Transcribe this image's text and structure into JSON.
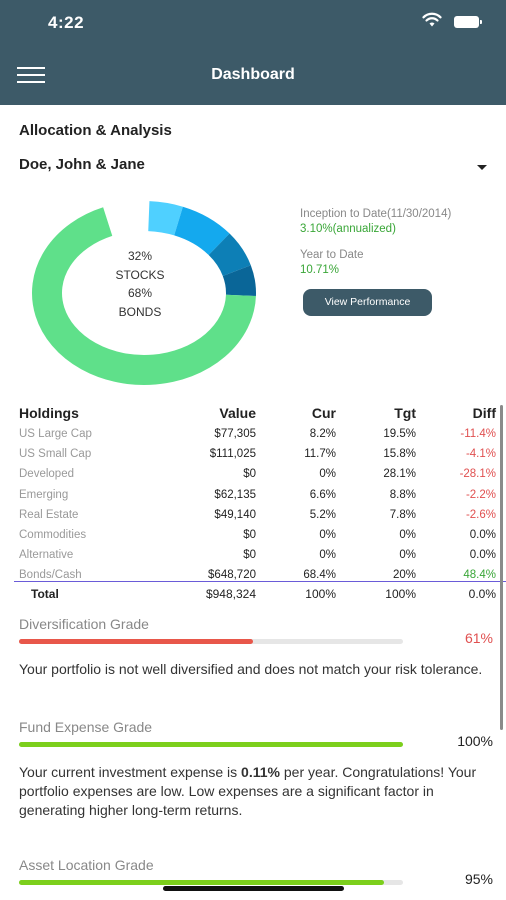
{
  "status_bar": {
    "time": "4:22",
    "wifi_icon": "wifi-icon",
    "battery_icon": "battery-icon"
  },
  "nav": {
    "menu_icon": "hamburger-menu-icon",
    "title": "Dashboard"
  },
  "section": {
    "title": "Allocation & Analysis"
  },
  "account": {
    "selected": "Doe, John & Jane",
    "chevron_icon": "chevron-down-icon"
  },
  "allocation": {
    "stocks_pct": "32%",
    "stocks_label": "STOCKS",
    "bonds_pct": "68%",
    "bonds_label": "BONDS",
    "segments": [
      {
        "color": "#4fd0ff",
        "fraction": 0.05
      },
      {
        "color": "#14a9ee",
        "fraction": 0.083
      },
      {
        "color": "#0d7fb6",
        "fraction": 0.062
      },
      {
        "color": "#0a6698",
        "fraction": 0.052
      },
      {
        "color": "#5fe08a",
        "fraction": 0.684
      }
    ],
    "colors": {
      "track": "#5fe08a"
    }
  },
  "performance": {
    "inception_label": "Inception to Date(11/30/2014)",
    "inception_value": "3.10%(annualized)",
    "ytd_label": "Year to Date",
    "ytd_value": "10.71%",
    "button_label": "View Performance"
  },
  "holdings": {
    "headers": [
      "Holdings",
      "Value",
      "Cur",
      "Tgt",
      "Diff"
    ],
    "rows": [
      {
        "name": "US Large Cap",
        "value": "$77,305",
        "cur": "8.2%",
        "tgt": "19.5%",
        "diff": "-11.4%",
        "sign": "neg"
      },
      {
        "name": "US Small Cap",
        "value": "$111,025",
        "cur": "11.7%",
        "tgt": "15.8%",
        "diff": "-4.1%",
        "sign": "neg"
      },
      {
        "name": "Developed",
        "value": "$0",
        "cur": "0%",
        "tgt": "28.1%",
        "diff": "-28.1%",
        "sign": "neg"
      },
      {
        "name": "Emerging",
        "value": "$62,135",
        "cur": "6.6%",
        "tgt": "8.8%",
        "diff": "-2.2%",
        "sign": "neg"
      },
      {
        "name": "Real Estate",
        "value": "$49,140",
        "cur": "5.2%",
        "tgt": "7.8%",
        "diff": "-2.6%",
        "sign": "neg"
      },
      {
        "name": "Commodities",
        "value": "$0",
        "cur": "0%",
        "tgt": "0%",
        "diff": "0.0%",
        "sign": "zero"
      },
      {
        "name": "Alternative",
        "value": "$0",
        "cur": "0%",
        "tgt": "0%",
        "diff": "0.0%",
        "sign": "zero"
      },
      {
        "name": "Bonds/Cash",
        "value": "$648,720",
        "cur": "68.4%",
        "tgt": "20%",
        "diff": "48.4%",
        "sign": "pos"
      }
    ],
    "total": {
      "name": "Total",
      "value": "$948,324",
      "cur": "100%",
      "tgt": "100%",
      "diff": "0.0%"
    }
  },
  "grades": {
    "diversification": {
      "title": "Diversification Grade",
      "pct": "61%",
      "fill_fraction": 0.61,
      "color": "#e8574a",
      "text": "Your portfolio is not well diversified and does not match your risk tolerance."
    },
    "expense": {
      "title": "Fund Expense Grade",
      "pct": "100%",
      "fill_fraction": 1.0,
      "color": "#7ccf1c",
      "text_before": "Your current investment expense is ",
      "text_bold": "0.11%",
      "text_after": " per year. Congratulations! Your portfolio expenses are low. Low expenses are a significant factor in generating higher long-term returns."
    },
    "location": {
      "title": "Asset Location Grade",
      "pct": "95%",
      "fill_fraction": 0.95,
      "color": "#7ccf1c"
    }
  },
  "colors": {
    "header_bg": "#3d5a68",
    "positive": "#39a637",
    "negative": "#e05050"
  }
}
